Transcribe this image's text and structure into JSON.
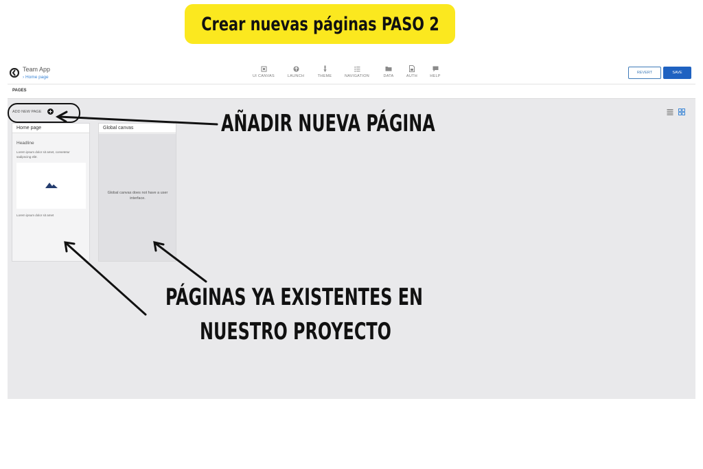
{
  "banner": {
    "text": "Crear nuevas páginas PASO 2",
    "bg_color": "#fbe81f"
  },
  "app": {
    "title": "Team App",
    "breadcrumb": "› Home page",
    "nav": [
      {
        "label": "UI CANVAS",
        "icon": "canvas-icon"
      },
      {
        "label": "LAUNCH",
        "icon": "launch-icon"
      },
      {
        "label": "THEME",
        "icon": "theme-brush-icon"
      },
      {
        "label": "NAVIGATION",
        "icon": "navigation-list-icon"
      },
      {
        "label": "DATA",
        "icon": "folder-icon"
      },
      {
        "label": "AUTH",
        "icon": "auth-document-icon"
      },
      {
        "label": "HELP",
        "icon": "help-chat-icon"
      }
    ],
    "revert_label": "REVERT",
    "save_label": "SAVE",
    "accent_color": "#1f62c1",
    "section_title": "PAGES",
    "add_new_label": "ADD NEW PAGE",
    "pages": [
      {
        "name": "Home page",
        "headline": "Headline",
        "lorem": "Lorem ipsum dolor sit amet, consetetur sadipscing elitr.",
        "footer_text": "Lorem ipsum dolor sit amet"
      },
      {
        "name": "Global canvas",
        "body_text": "Global canvas does not have a user interface."
      }
    ]
  },
  "annotations": {
    "add_page": "AÑADIR NUEVA PÁGINA",
    "existing_line1": "PÁGINAS YA EXISTENTES EN",
    "existing_line2": "NUESTRO PROYECTO"
  }
}
